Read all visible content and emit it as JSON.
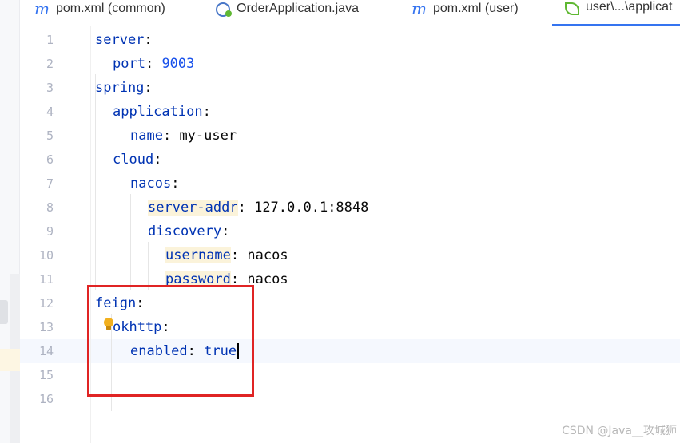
{
  "tabs": [
    {
      "icon": "maven-icon",
      "glyph": "m",
      "label": "pom.xml (common)",
      "active": false
    },
    {
      "icon": "java-class-icon",
      "glyph": "",
      "label": "OrderApplication.java",
      "active": false
    },
    {
      "icon": "maven-icon",
      "glyph": "m",
      "label": "pom.xml (user)",
      "active": false
    },
    {
      "icon": "spring-yaml-icon",
      "glyph": "",
      "label": "user\\...\\applicat",
      "active": true
    }
  ],
  "editor": {
    "lines": [
      {
        "n": "1",
        "key": "server",
        "sep": ":",
        "value": ""
      },
      {
        "n": "2",
        "key": "port",
        "sep": ": ",
        "value": "9003"
      },
      {
        "n": "3",
        "key": "spring",
        "sep": ":",
        "value": ""
      },
      {
        "n": "4",
        "key": "application",
        "sep": ":",
        "value": ""
      },
      {
        "n": "5",
        "key": "name",
        "sep": ": ",
        "value": "my-user"
      },
      {
        "n": "6",
        "key": "cloud",
        "sep": ":",
        "value": ""
      },
      {
        "n": "7",
        "key": "nacos",
        "sep": ":",
        "value": ""
      },
      {
        "n": "8",
        "key": "server-addr",
        "sep": ": ",
        "value": "127.0.0.1:8848"
      },
      {
        "n": "9",
        "key": "discovery",
        "sep": ":",
        "value": ""
      },
      {
        "n": "10",
        "key": "username",
        "sep": ": ",
        "value": "nacos"
      },
      {
        "n": "11",
        "key": "password",
        "sep": ": ",
        "value": "nacos"
      },
      {
        "n": "12",
        "key": "feign",
        "sep": ":",
        "value": ""
      },
      {
        "n": "13",
        "key": "okhttp",
        "sep": ":",
        "value": ""
      },
      {
        "n": "14",
        "key": "enabled",
        "sep": ": ",
        "value": "true"
      },
      {
        "n": "15",
        "key": "",
        "sep": "",
        "value": ""
      },
      {
        "n": "16",
        "key": "",
        "sep": "",
        "value": ""
      }
    ],
    "highlight_color": "#e02424"
  },
  "watermark": "CSDN @Java__攻城狮"
}
